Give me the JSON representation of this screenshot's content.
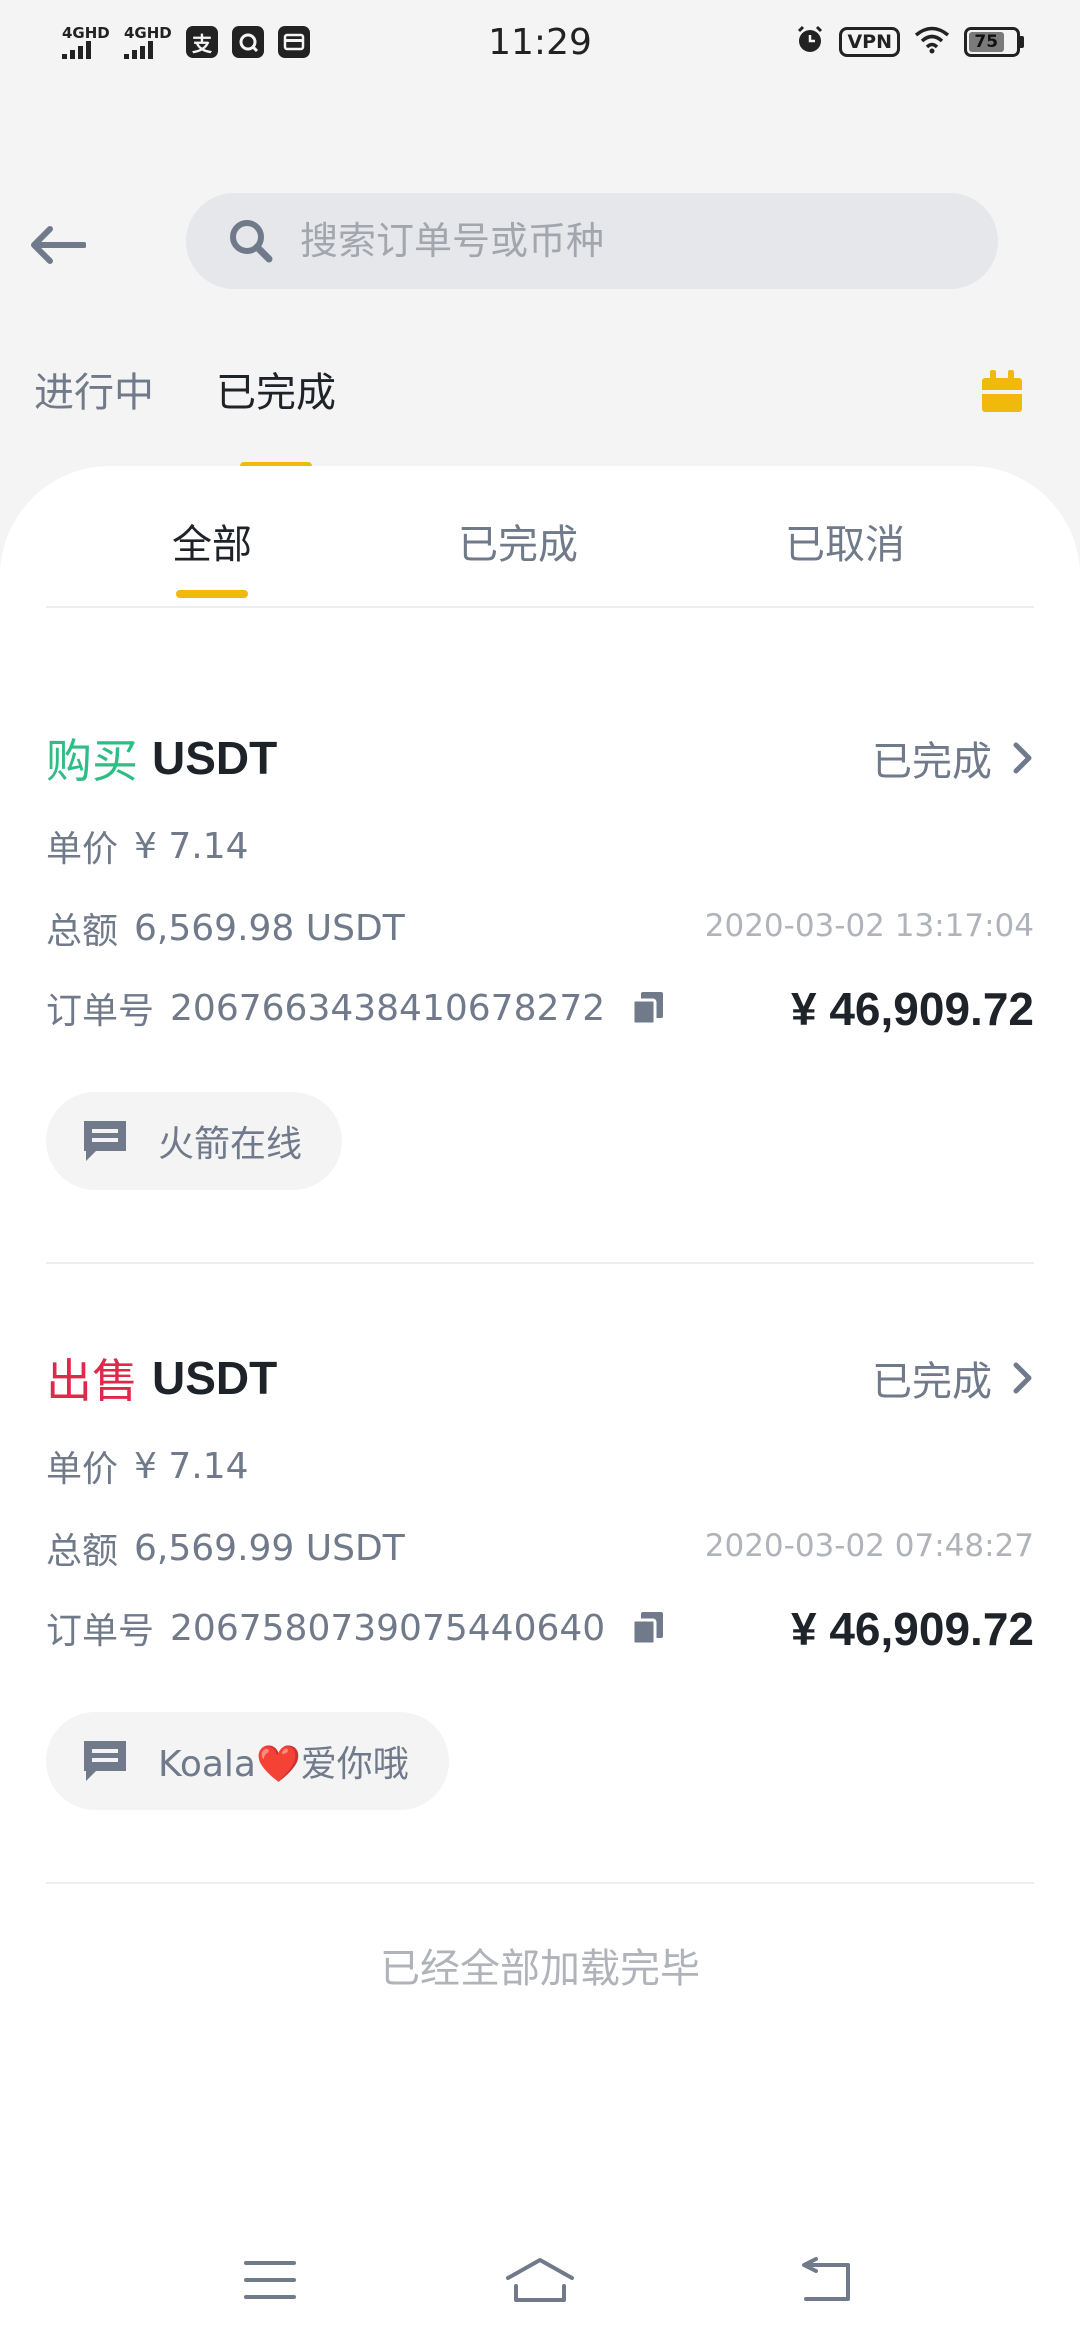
{
  "status_bar": {
    "network_1": "4GHD",
    "network_2": "4GHD",
    "app_icon_1": "支",
    "time": "11:29",
    "vpn": "VPN",
    "battery": "75"
  },
  "header": {
    "search_placeholder": "搜索订单号或币种"
  },
  "top_tabs": [
    {
      "label": "进行中",
      "active": false
    },
    {
      "label": "已完成",
      "active": true
    }
  ],
  "sub_tabs": [
    {
      "label": "全部",
      "active": true
    },
    {
      "label": "已完成",
      "active": false
    },
    {
      "label": "已取消",
      "active": false
    }
  ],
  "orders": [
    {
      "side": "购买",
      "coin": "USDT",
      "status": "已完成",
      "price_label": "单价",
      "price": "¥ 7.14",
      "total_label": "总额",
      "total": "6,569.98 USDT",
      "time": "2020-03-02 13:17:04",
      "order_no_label": "订单号",
      "order_no": "2067663438410678272",
      "amount": "¥ 46,909.72",
      "merchant": "火箭在线"
    },
    {
      "side": "出售",
      "coin": "USDT",
      "status": "已完成",
      "price_label": "单价",
      "price": "¥ 7.14",
      "total_label": "总额",
      "total": "6,569.99 USDT",
      "time": "2020-03-02 07:48:27",
      "order_no_label": "订单号",
      "order_no": "2067580739075440640",
      "amount": "¥ 46,909.72",
      "merchant": "Koala❤️爱你哦"
    }
  ],
  "footer": {
    "end_text": "已经全部加载完毕"
  },
  "colors": {
    "accent": "#f0b90b",
    "buy": "#2ebd85",
    "sell": "#e0294a",
    "text_primary": "#1e2329",
    "text_secondary": "#707a8a"
  },
  "icons": [
    "back-arrow-icon",
    "search-icon",
    "calendar-icon",
    "chevron-right-icon",
    "copy-icon",
    "chat-icon",
    "menu-icon",
    "home-icon",
    "return-icon"
  ]
}
